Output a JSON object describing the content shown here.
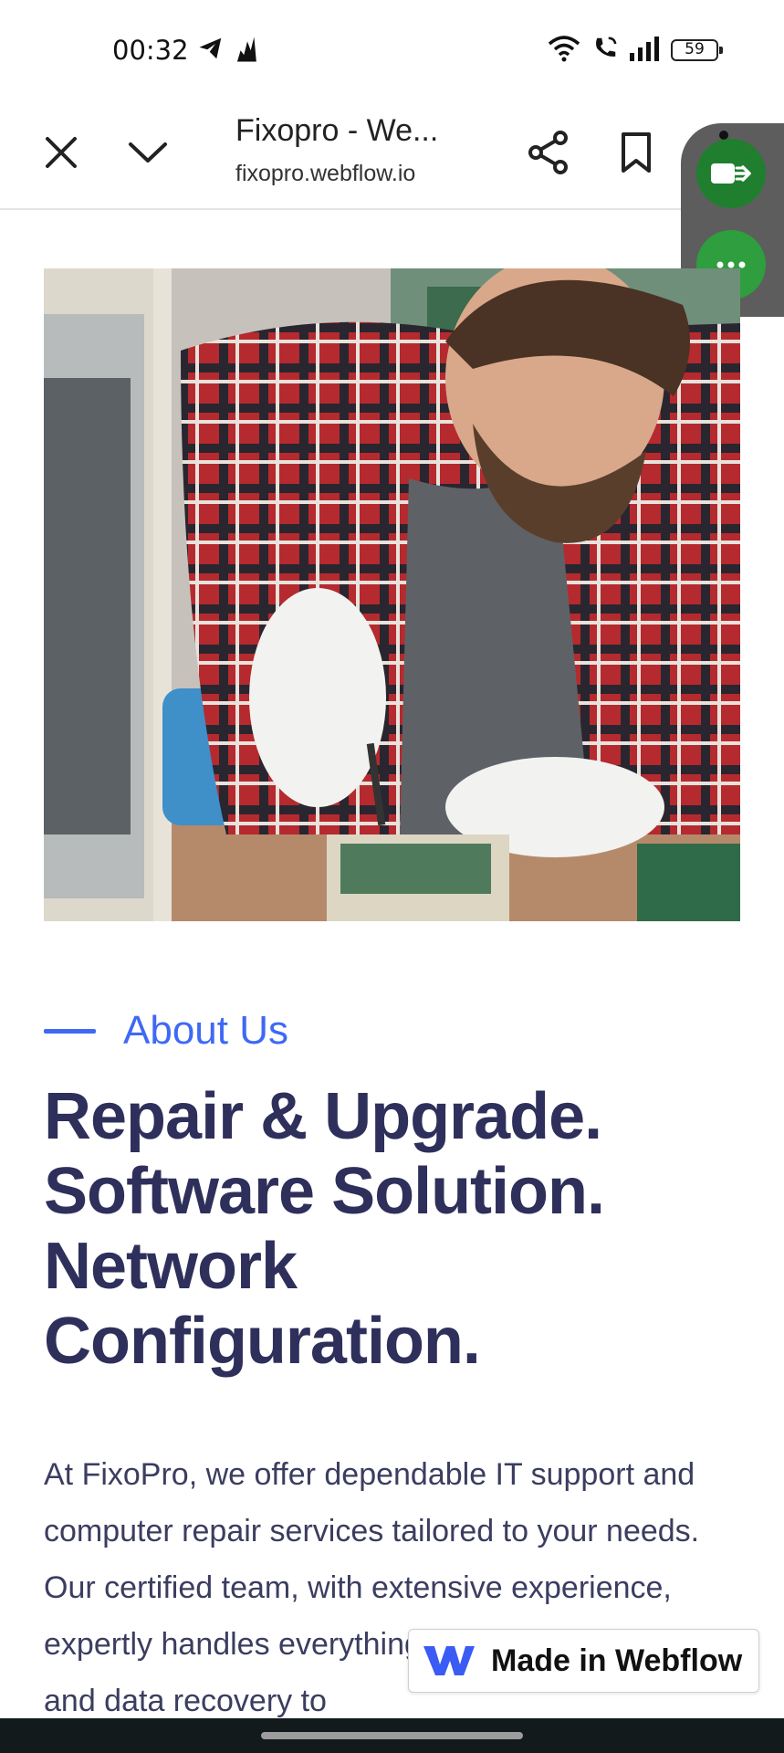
{
  "status_bar": {
    "time": "00:32",
    "battery": "59",
    "icons": [
      "telegram-icon",
      "signal-app-icon",
      "wifi-icon",
      "wifi-call-icon",
      "cellular-signal-icon",
      "battery-icon"
    ]
  },
  "browser": {
    "title": "Fixopro - We...",
    "url": "fixopro.webflow.io",
    "icons": [
      "close-icon",
      "chevron-down-icon",
      "share-icon",
      "bookmark-icon",
      "switch-app-icon",
      "more-icon"
    ]
  },
  "hero": {
    "description_icon": "photo-technician-repairing-computer"
  },
  "about": {
    "label": "About Us",
    "headline_lines": [
      "Repair & Upgrade.",
      "Software Solution.",
      "Network",
      "Configuration."
    ],
    "body": "At FixoPro, we offer dependable IT support and computer repair services tailored to your needs. Our certified team, with extensive experience, expertly handles everything from troubleshooting and data recovery to"
  },
  "badge": {
    "text": "Made in Webflow"
  },
  "colors": {
    "accent": "#3f69f4",
    "heading": "#2e2f5b",
    "fab_green": "#2e9e3e",
    "nav_bar": "#121a1c"
  }
}
